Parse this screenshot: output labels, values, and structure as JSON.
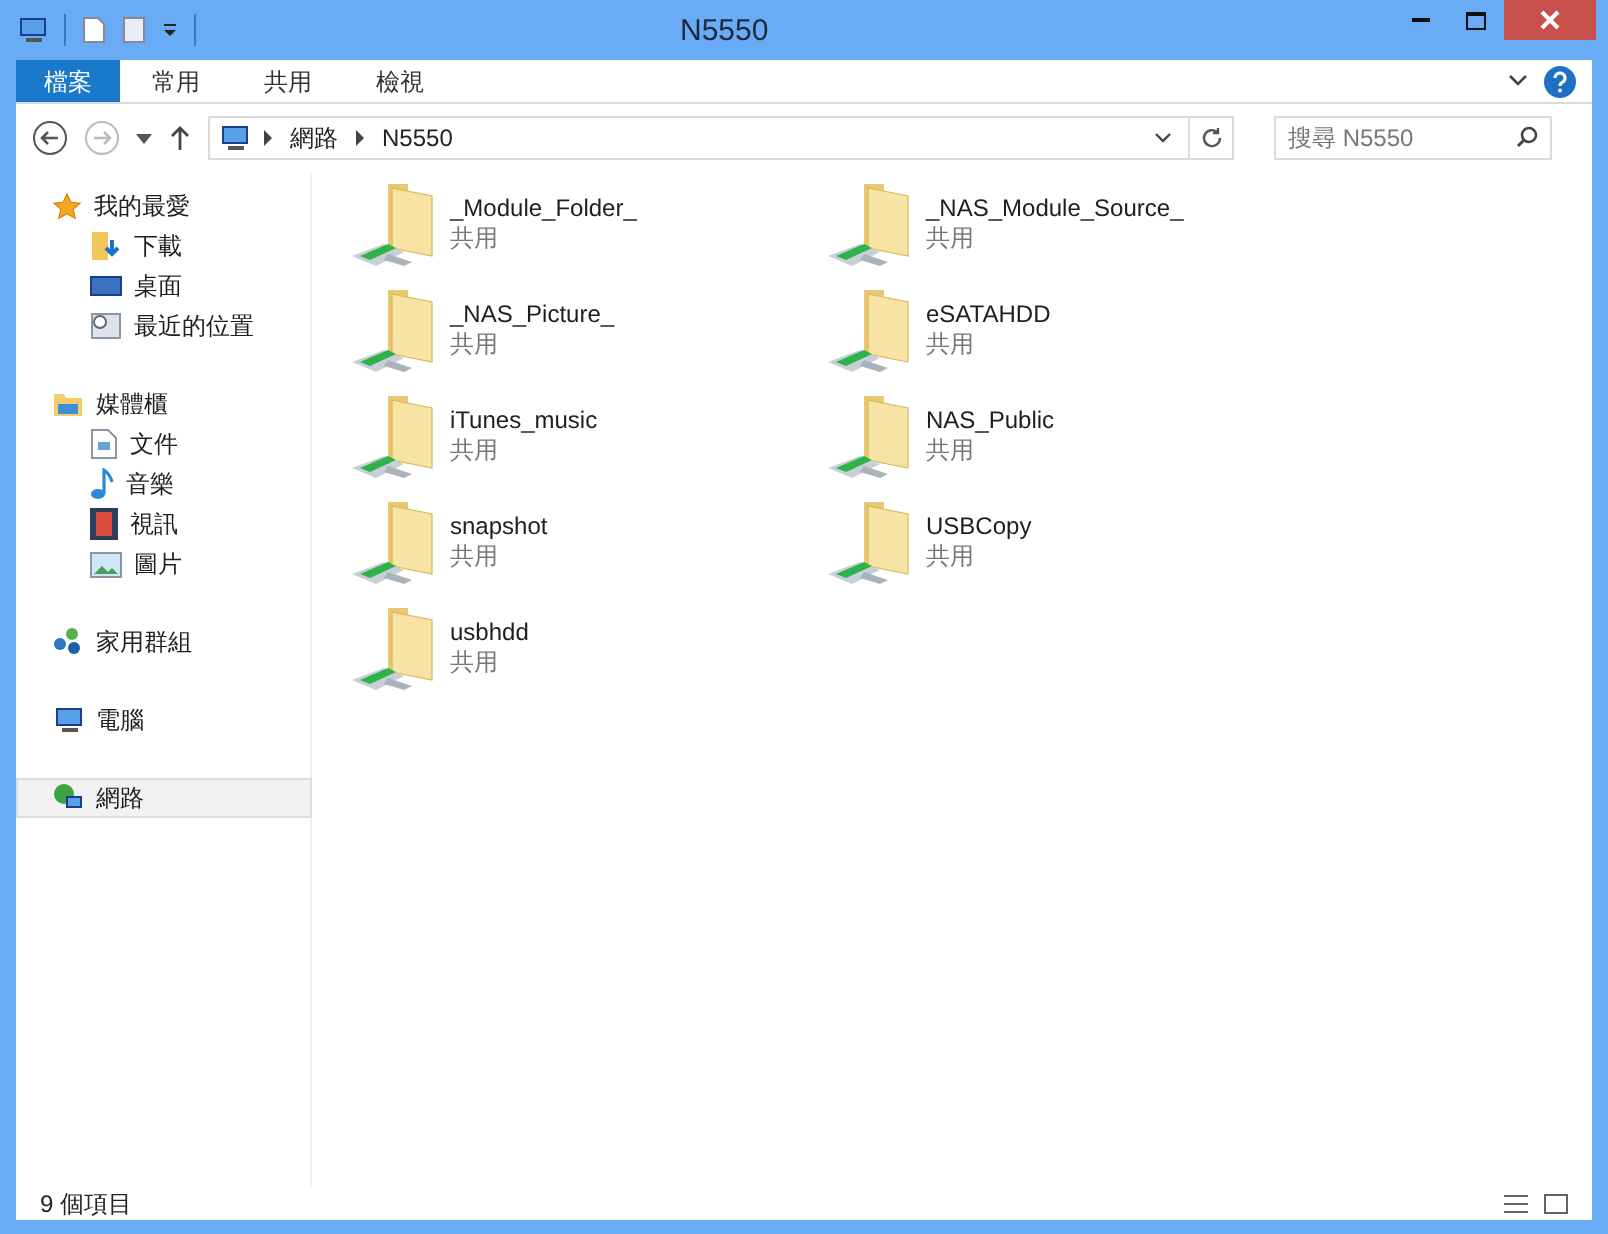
{
  "window": {
    "title": "N5550"
  },
  "ribbon_tabs": [
    {
      "label": "檔案",
      "kind": "file"
    },
    {
      "label": "常用",
      "kind": "tab"
    },
    {
      "label": "共用",
      "kind": "tab"
    },
    {
      "label": "檢視",
      "kind": "tab"
    }
  ],
  "address": {
    "crumbs": [
      "網路",
      "N5550"
    ]
  },
  "search": {
    "placeholder": "搜尋 N5550"
  },
  "navigation": [
    {
      "label": "我的最愛",
      "selected": false,
      "children": [
        {
          "label": "下載"
        },
        {
          "label": "桌面"
        },
        {
          "label": "最近的位置"
        }
      ]
    },
    {
      "label": "媒體櫃",
      "selected": false,
      "children": [
        {
          "label": "文件"
        },
        {
          "label": "音樂"
        },
        {
          "label": "視訊"
        },
        {
          "label": "圖片"
        }
      ]
    },
    {
      "label": "家用群組",
      "selected": false
    },
    {
      "label": "電腦",
      "selected": false
    },
    {
      "label": "網路",
      "selected": true
    }
  ],
  "items": [
    {
      "name": "_Module_Folder_",
      "subtitle": "共用"
    },
    {
      "name": "_NAS_Module_Source_",
      "subtitle": "共用"
    },
    {
      "name": "_NAS_Picture_",
      "subtitle": "共用"
    },
    {
      "name": "eSATAHDD",
      "subtitle": "共用"
    },
    {
      "name": "iTunes_music",
      "subtitle": "共用"
    },
    {
      "name": "NAS_Public",
      "subtitle": "共用"
    },
    {
      "name": "snapshot",
      "subtitle": "共用"
    },
    {
      "name": "USBCopy",
      "subtitle": "共用"
    },
    {
      "name": "usbhdd",
      "subtitle": "共用"
    }
  ],
  "status_bar": {
    "text": "9 個項目"
  }
}
